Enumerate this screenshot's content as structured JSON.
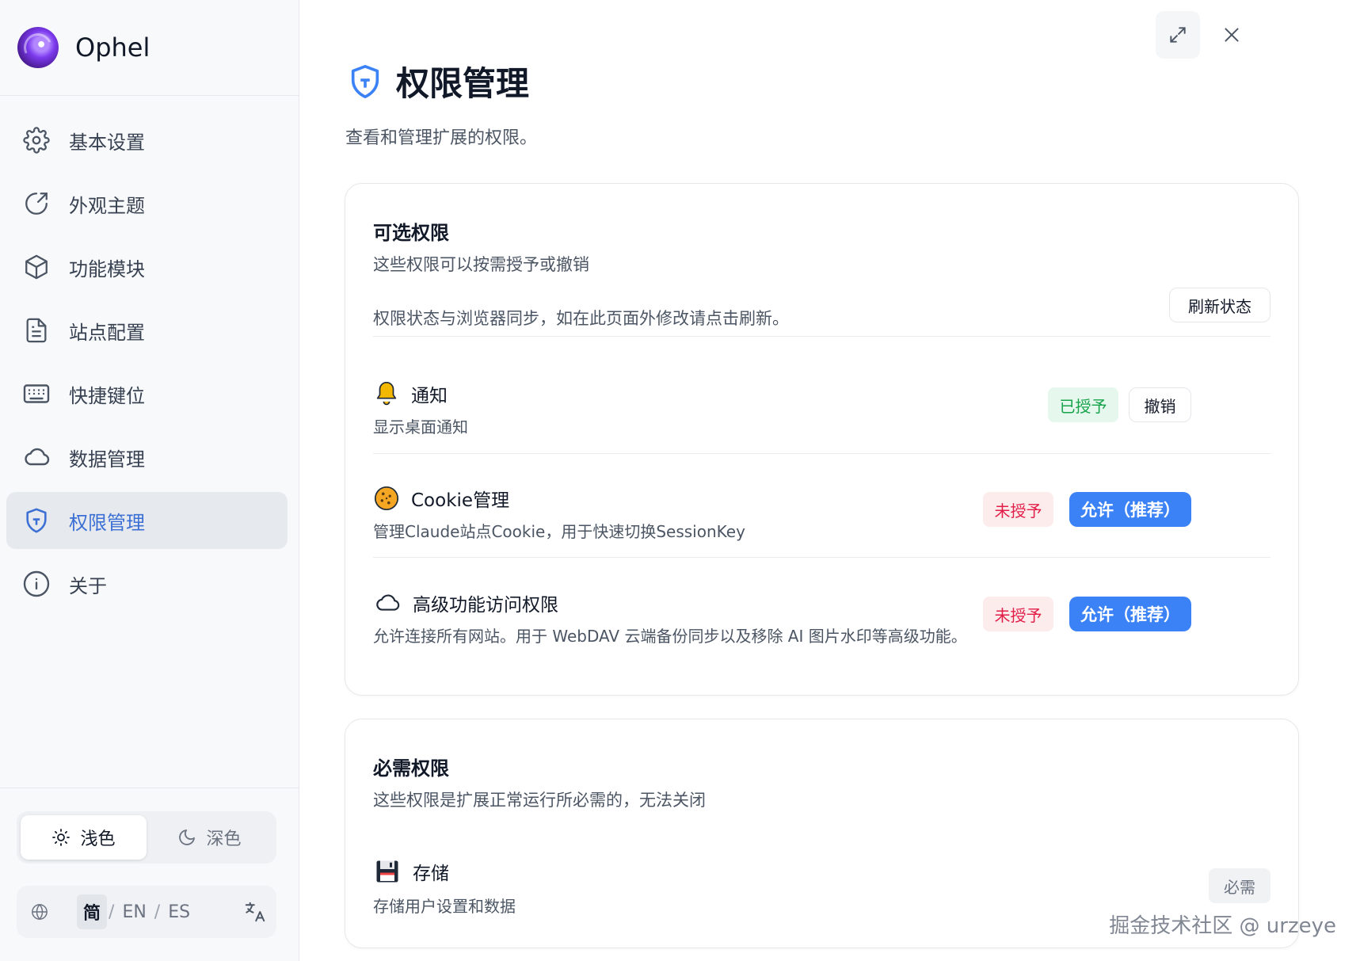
{
  "brand": {
    "name": "Ophel"
  },
  "sidebar": {
    "items": [
      {
        "label": "基本设置",
        "icon": "gear-icon"
      },
      {
        "label": "外观主题",
        "icon": "palette-icon"
      },
      {
        "label": "功能模块",
        "icon": "cube-icon"
      },
      {
        "label": "站点配置",
        "icon": "document-icon"
      },
      {
        "label": "快捷键位",
        "icon": "keyboard-icon"
      },
      {
        "label": "数据管理",
        "icon": "cloud-icon"
      },
      {
        "label": "权限管理",
        "icon": "shield-icon",
        "active": true
      },
      {
        "label": "关于",
        "icon": "info-icon"
      }
    ],
    "theme": {
      "light": "浅色",
      "dark": "深色",
      "selected": "light"
    },
    "languages": {
      "zh": "简",
      "en": "EN",
      "es": "ES",
      "sep": "/",
      "selected": "zh"
    }
  },
  "page": {
    "title": "权限管理",
    "subtitle": "查看和管理扩展的权限。"
  },
  "optional": {
    "title": "可选权限",
    "desc": "这些权限可以按需授予或撤销",
    "sync_text": "权限状态与浏览器同步，如在此页面外修改请点击刷新。",
    "refresh_label": "刷新状态",
    "items": [
      {
        "name": "通知",
        "desc": "显示桌面通知",
        "status": "已授予",
        "action": "撤销",
        "icon": "bell-icon"
      },
      {
        "name": "Cookie管理",
        "desc": "管理Claude站点Cookie，用于快速切换SessionKey",
        "status": "未授予",
        "action": "允许（推荐）",
        "icon": "cookie-icon"
      },
      {
        "name": "高级功能访问权限",
        "desc": "允许连接所有网站。用于 WebDAV 云端备份同步以及移除 AI 图片水印等高级功能。",
        "status": "未授予",
        "action": "允许（推荐）",
        "icon": "cloud-icon"
      }
    ]
  },
  "required": {
    "title": "必需权限",
    "desc": "这些权限是扩展正常运行所必需的，无法关闭",
    "items": [
      {
        "name": "存储",
        "desc": "存储用户设置和数据",
        "status": "必需",
        "icon": "floppy-disk-icon"
      }
    ]
  },
  "watermark": "掘金技术社区 @ urzeye",
  "colors": {
    "accent": "#3b82f6",
    "active_nav": "#3b6fd4",
    "granted": "#16a34a",
    "denied": "#e11d48"
  }
}
